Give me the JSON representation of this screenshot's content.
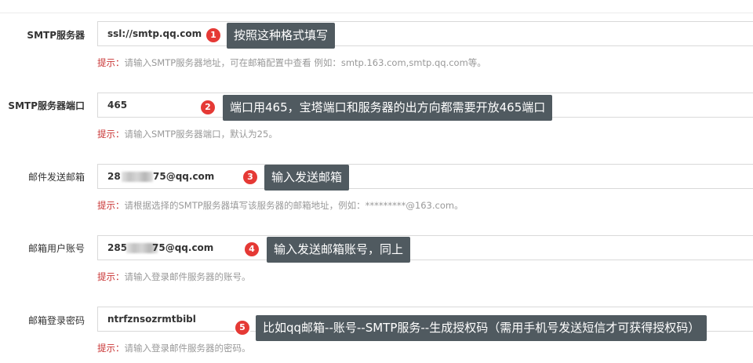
{
  "rows": [
    {
      "label": "SMTP服务器",
      "value": "ssl://smtp.qq.com",
      "hint_key": "提示：",
      "hint_text": "请输入SMTP服务器地址，可在邮箱配置中查看 例如：smtp.163.com,smtp.qq.com等。",
      "badge": "1",
      "tip": "按照这种格式填写"
    },
    {
      "label": "SMTP服务器端口",
      "value": "465",
      "hint_key": "提示：",
      "hint_text": "请输入SMTP服务器端口，默认为25。",
      "badge": "2",
      "tip": "端口用465，宝塔端口和服务器的出方向都需要开放465端口"
    },
    {
      "label": "邮件发送邮箱",
      "value_prefix": "28",
      "value_suffix": "75@qq.com",
      "hint_key": "提示：",
      "hint_text": "请根据选择的SMTP服务器填写该服务器的邮箱地址，例如：*********@163.com。",
      "badge": "3",
      "tip": "输入发送邮箱"
    },
    {
      "label": "邮箱用户账号",
      "value_prefix": "285",
      "value_suffix": "75@qq.com",
      "hint_key": "提示：",
      "hint_text": "请输入登录邮件服务器的账号。",
      "badge": "4",
      "tip": "输入发送邮箱账号，同上"
    },
    {
      "label": "邮箱登录密码",
      "value": "ntrfznsozrmtbibl",
      "hint_key": "提示：",
      "hint_text": "请输入登录邮件服务器的密码。",
      "badge": "5",
      "tip": "比如qq邮箱--账号--SMTP服务--生成授权码（需用手机号发送短信才可获得授权码）"
    }
  ],
  "colors": {
    "badge": "#e53935",
    "tip_bg": "#505a60",
    "hint_key": "#c83232",
    "hint_text": "#999999"
  }
}
